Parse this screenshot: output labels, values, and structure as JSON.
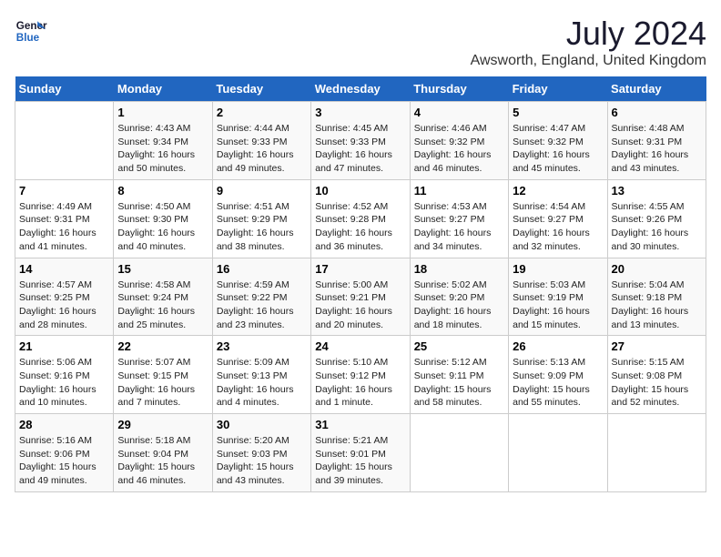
{
  "header": {
    "logo_line1": "General",
    "logo_line2": "Blue",
    "main_title": "July 2024",
    "subtitle": "Awsworth, England, United Kingdom"
  },
  "days_of_week": [
    "Sunday",
    "Monday",
    "Tuesday",
    "Wednesday",
    "Thursday",
    "Friday",
    "Saturday"
  ],
  "weeks": [
    [
      {
        "day": "",
        "sunrise": "",
        "sunset": "",
        "daylight": ""
      },
      {
        "day": "1",
        "sunrise": "Sunrise: 4:43 AM",
        "sunset": "Sunset: 9:34 PM",
        "daylight": "Daylight: 16 hours and 50 minutes."
      },
      {
        "day": "2",
        "sunrise": "Sunrise: 4:44 AM",
        "sunset": "Sunset: 9:33 PM",
        "daylight": "Daylight: 16 hours and 49 minutes."
      },
      {
        "day": "3",
        "sunrise": "Sunrise: 4:45 AM",
        "sunset": "Sunset: 9:33 PM",
        "daylight": "Daylight: 16 hours and 47 minutes."
      },
      {
        "day": "4",
        "sunrise": "Sunrise: 4:46 AM",
        "sunset": "Sunset: 9:32 PM",
        "daylight": "Daylight: 16 hours and 46 minutes."
      },
      {
        "day": "5",
        "sunrise": "Sunrise: 4:47 AM",
        "sunset": "Sunset: 9:32 PM",
        "daylight": "Daylight: 16 hours and 45 minutes."
      },
      {
        "day": "6",
        "sunrise": "Sunrise: 4:48 AM",
        "sunset": "Sunset: 9:31 PM",
        "daylight": "Daylight: 16 hours and 43 minutes."
      }
    ],
    [
      {
        "day": "7",
        "sunrise": "Sunrise: 4:49 AM",
        "sunset": "Sunset: 9:31 PM",
        "daylight": "Daylight: 16 hours and 41 minutes."
      },
      {
        "day": "8",
        "sunrise": "Sunrise: 4:50 AM",
        "sunset": "Sunset: 9:30 PM",
        "daylight": "Daylight: 16 hours and 40 minutes."
      },
      {
        "day": "9",
        "sunrise": "Sunrise: 4:51 AM",
        "sunset": "Sunset: 9:29 PM",
        "daylight": "Daylight: 16 hours and 38 minutes."
      },
      {
        "day": "10",
        "sunrise": "Sunrise: 4:52 AM",
        "sunset": "Sunset: 9:28 PM",
        "daylight": "Daylight: 16 hours and 36 minutes."
      },
      {
        "day": "11",
        "sunrise": "Sunrise: 4:53 AM",
        "sunset": "Sunset: 9:27 PM",
        "daylight": "Daylight: 16 hours and 34 minutes."
      },
      {
        "day": "12",
        "sunrise": "Sunrise: 4:54 AM",
        "sunset": "Sunset: 9:27 PM",
        "daylight": "Daylight: 16 hours and 32 minutes."
      },
      {
        "day": "13",
        "sunrise": "Sunrise: 4:55 AM",
        "sunset": "Sunset: 9:26 PM",
        "daylight": "Daylight: 16 hours and 30 minutes."
      }
    ],
    [
      {
        "day": "14",
        "sunrise": "Sunrise: 4:57 AM",
        "sunset": "Sunset: 9:25 PM",
        "daylight": "Daylight: 16 hours and 28 minutes."
      },
      {
        "day": "15",
        "sunrise": "Sunrise: 4:58 AM",
        "sunset": "Sunset: 9:24 PM",
        "daylight": "Daylight: 16 hours and 25 minutes."
      },
      {
        "day": "16",
        "sunrise": "Sunrise: 4:59 AM",
        "sunset": "Sunset: 9:22 PM",
        "daylight": "Daylight: 16 hours and 23 minutes."
      },
      {
        "day": "17",
        "sunrise": "Sunrise: 5:00 AM",
        "sunset": "Sunset: 9:21 PM",
        "daylight": "Daylight: 16 hours and 20 minutes."
      },
      {
        "day": "18",
        "sunrise": "Sunrise: 5:02 AM",
        "sunset": "Sunset: 9:20 PM",
        "daylight": "Daylight: 16 hours and 18 minutes."
      },
      {
        "day": "19",
        "sunrise": "Sunrise: 5:03 AM",
        "sunset": "Sunset: 9:19 PM",
        "daylight": "Daylight: 16 hours and 15 minutes."
      },
      {
        "day": "20",
        "sunrise": "Sunrise: 5:04 AM",
        "sunset": "Sunset: 9:18 PM",
        "daylight": "Daylight: 16 hours and 13 minutes."
      }
    ],
    [
      {
        "day": "21",
        "sunrise": "Sunrise: 5:06 AM",
        "sunset": "Sunset: 9:16 PM",
        "daylight": "Daylight: 16 hours and 10 minutes."
      },
      {
        "day": "22",
        "sunrise": "Sunrise: 5:07 AM",
        "sunset": "Sunset: 9:15 PM",
        "daylight": "Daylight: 16 hours and 7 minutes."
      },
      {
        "day": "23",
        "sunrise": "Sunrise: 5:09 AM",
        "sunset": "Sunset: 9:13 PM",
        "daylight": "Daylight: 16 hours and 4 minutes."
      },
      {
        "day": "24",
        "sunrise": "Sunrise: 5:10 AM",
        "sunset": "Sunset: 9:12 PM",
        "daylight": "Daylight: 16 hours and 1 minute."
      },
      {
        "day": "25",
        "sunrise": "Sunrise: 5:12 AM",
        "sunset": "Sunset: 9:11 PM",
        "daylight": "Daylight: 15 hours and 58 minutes."
      },
      {
        "day": "26",
        "sunrise": "Sunrise: 5:13 AM",
        "sunset": "Sunset: 9:09 PM",
        "daylight": "Daylight: 15 hours and 55 minutes."
      },
      {
        "day": "27",
        "sunrise": "Sunrise: 5:15 AM",
        "sunset": "Sunset: 9:08 PM",
        "daylight": "Daylight: 15 hours and 52 minutes."
      }
    ],
    [
      {
        "day": "28",
        "sunrise": "Sunrise: 5:16 AM",
        "sunset": "Sunset: 9:06 PM",
        "daylight": "Daylight: 15 hours and 49 minutes."
      },
      {
        "day": "29",
        "sunrise": "Sunrise: 5:18 AM",
        "sunset": "Sunset: 9:04 PM",
        "daylight": "Daylight: 15 hours and 46 minutes."
      },
      {
        "day": "30",
        "sunrise": "Sunrise: 5:20 AM",
        "sunset": "Sunset: 9:03 PM",
        "daylight": "Daylight: 15 hours and 43 minutes."
      },
      {
        "day": "31",
        "sunrise": "Sunrise: 5:21 AM",
        "sunset": "Sunset: 9:01 PM",
        "daylight": "Daylight: 15 hours and 39 minutes."
      },
      {
        "day": "",
        "sunrise": "",
        "sunset": "",
        "daylight": ""
      },
      {
        "day": "",
        "sunrise": "",
        "sunset": "",
        "daylight": ""
      },
      {
        "day": "",
        "sunrise": "",
        "sunset": "",
        "daylight": ""
      }
    ]
  ]
}
